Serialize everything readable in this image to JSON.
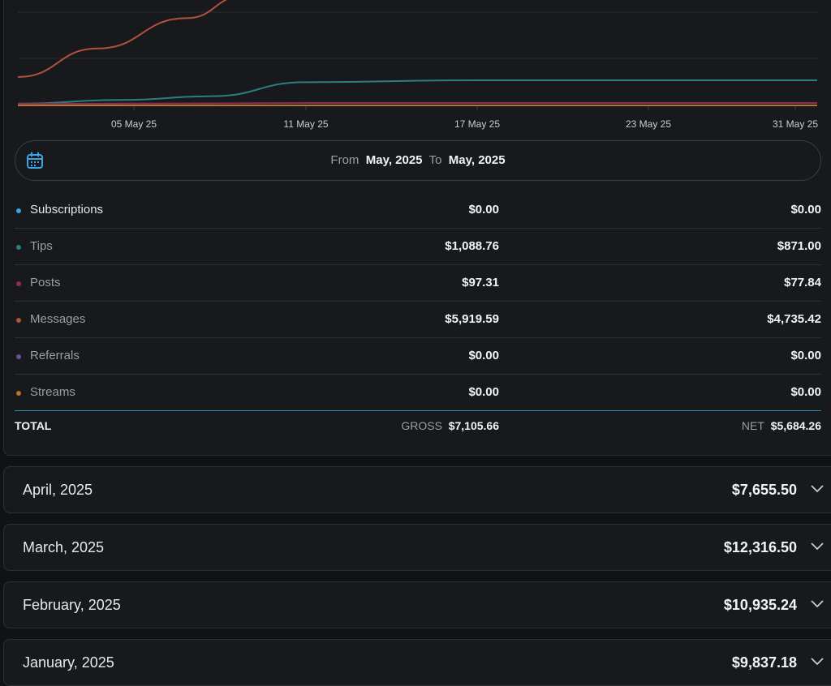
{
  "chart_data": {
    "type": "line",
    "x_ticks": [
      "05 May 25",
      "11 May 25",
      "17 May 25",
      "23 May 25",
      "31 May 25"
    ],
    "series": [
      {
        "name": "Subscriptions",
        "color": "#3aa6e6",
        "values": [
          0,
          0,
          0,
          0,
          0,
          0,
          0
        ]
      },
      {
        "name": "Tips",
        "color": "#2a7f80",
        "values": [
          10,
          180,
          350,
          1000,
          1088.76,
          1088.76,
          1088.76
        ]
      },
      {
        "name": "Posts",
        "color": "#8a2f55",
        "values": [
          0,
          20,
          50,
          97.31,
          97.31,
          97.31,
          97.31
        ]
      },
      {
        "name": "Messages",
        "color": "#b0533e",
        "values": [
          1200,
          2800,
          4500,
          5919.59
        ]
      },
      {
        "name": "Referrals",
        "color": "#6a4f9a",
        "values": [
          0,
          0,
          0,
          0,
          0,
          0,
          0
        ]
      },
      {
        "name": "Streams",
        "color": "#b8732a",
        "values": [
          0,
          0,
          0,
          0,
          0,
          0,
          0
        ]
      }
    ]
  },
  "date_range": {
    "icon": "calendar-icon",
    "from_label": "From",
    "from_value": "May, 2025",
    "to_label": "To",
    "to_value": "May, 2025"
  },
  "rows": [
    {
      "label": "Subscriptions",
      "gross": "$0.00",
      "net": "$0.00",
      "color": "#3aa6e6"
    },
    {
      "label": "Tips",
      "gross": "$1,088.76",
      "net": "$871.00",
      "color": "#2a7f80"
    },
    {
      "label": "Posts",
      "gross": "$97.31",
      "net": "$77.84",
      "color": "#8a2f55"
    },
    {
      "label": "Messages",
      "gross": "$5,919.59",
      "net": "$4,735.42",
      "color": "#b0533e"
    },
    {
      "label": "Referrals",
      "gross": "$0.00",
      "net": "$0.00",
      "color": "#6a4f9a"
    },
    {
      "label": "Streams",
      "gross": "$0.00",
      "net": "$0.00",
      "color": "#b8732a"
    }
  ],
  "total": {
    "label": "TOTAL",
    "gross_label": "GROSS",
    "gross_value": "$7,105.66",
    "net_label": "NET",
    "net_value": "$5,684.26"
  },
  "months": [
    {
      "label": "April, 2025",
      "amount": "$7,655.50"
    },
    {
      "label": "March, 2025",
      "amount": "$12,316.50"
    },
    {
      "label": "February, 2025",
      "amount": "$10,935.24"
    },
    {
      "label": "January, 2025",
      "amount": "$9,837.18"
    }
  ]
}
